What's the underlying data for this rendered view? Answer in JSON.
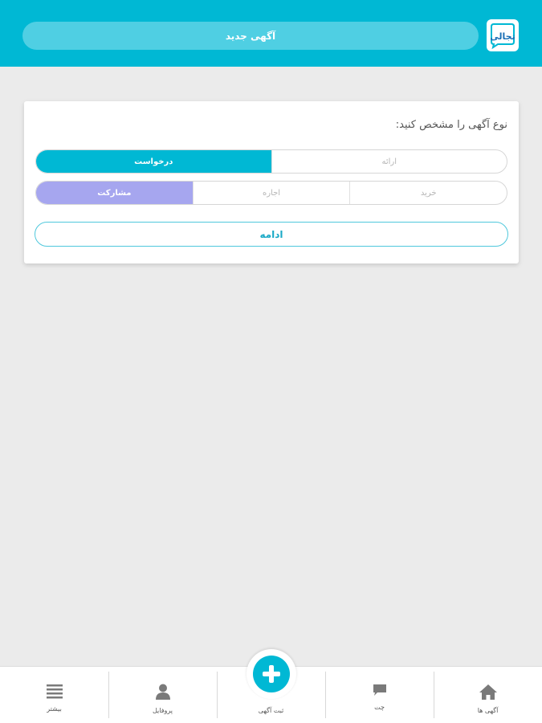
{
  "header": {
    "title": "آگهی جدید",
    "logo_text": "تجالی",
    "colors": {
      "bar": "#00b8d4",
      "pill": "#4fcfe3"
    }
  },
  "card": {
    "prompt": "نوع آگهی را مشخص کنید:",
    "row1": {
      "offer": "ارائه",
      "request": "درخواست",
      "selected": "درخواست"
    },
    "row2": {
      "buy": "خرید",
      "rent": "اجاره",
      "partnership": "مشارکت",
      "selected": "مشارکت"
    },
    "continue_label": "ادامه",
    "colors": {
      "selected_primary": "#00b8d4",
      "selected_secondary": "#a6a6ef"
    }
  },
  "bottom_nav": {
    "items": [
      {
        "label": "آگهی ها",
        "icon": "home-icon"
      },
      {
        "label": "چت",
        "icon": "chat-icon"
      },
      {
        "label": "ثبت آگهی",
        "icon": "plus-icon"
      },
      {
        "label": "پروفایل",
        "icon": "user-icon"
      },
      {
        "label": "بیشتر",
        "icon": "menu-icon"
      }
    ]
  }
}
